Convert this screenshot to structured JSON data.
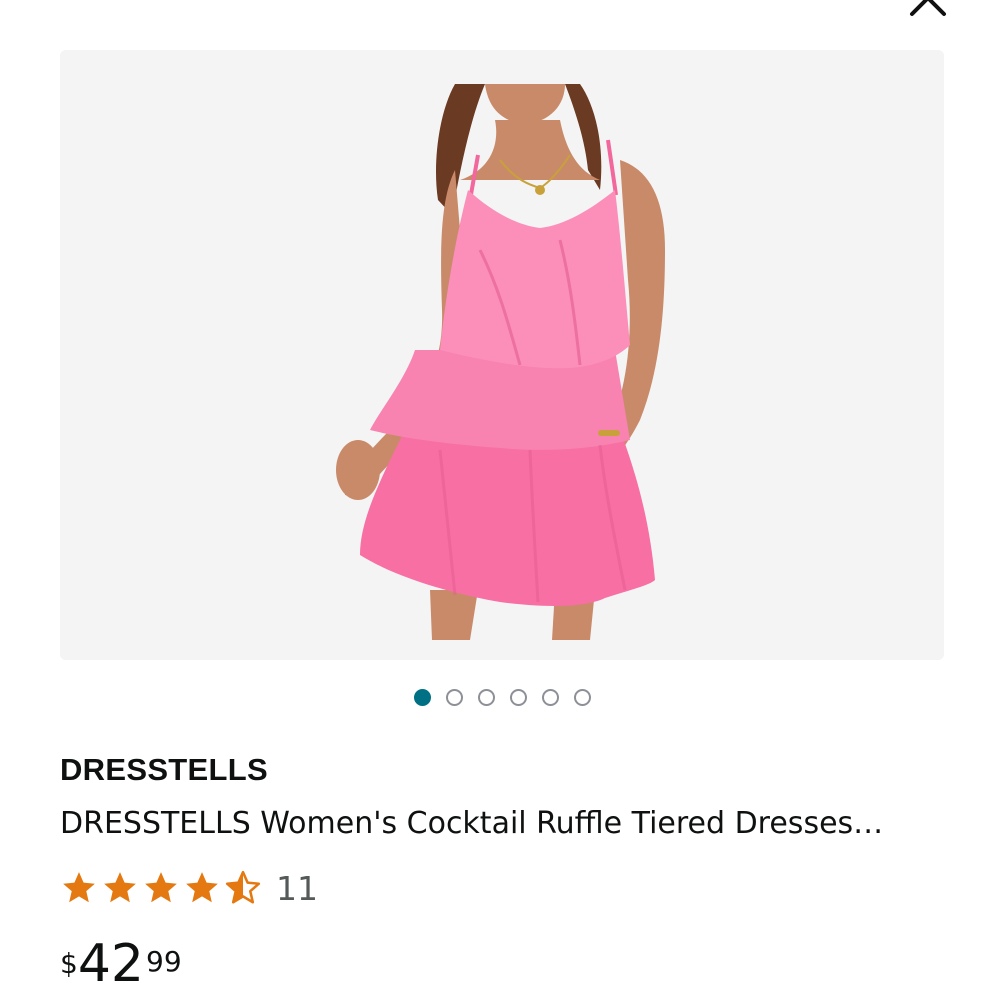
{
  "header": {
    "close_icon": "close-icon"
  },
  "gallery": {
    "image_alt": "Pink ruffle tiered cocktail mini dress",
    "dots": [
      true,
      false,
      false,
      false,
      false,
      false
    ],
    "accent": "#007185"
  },
  "product": {
    "brand": "DRESSTELLS",
    "title": "DRESSTELLS Women's Cocktail Ruffle Tiered Dresses…",
    "rating": 4.5,
    "review_count": "11",
    "star_color": "#e47911",
    "price": {
      "symbol": "$",
      "whole": "42",
      "fraction": "99"
    }
  }
}
